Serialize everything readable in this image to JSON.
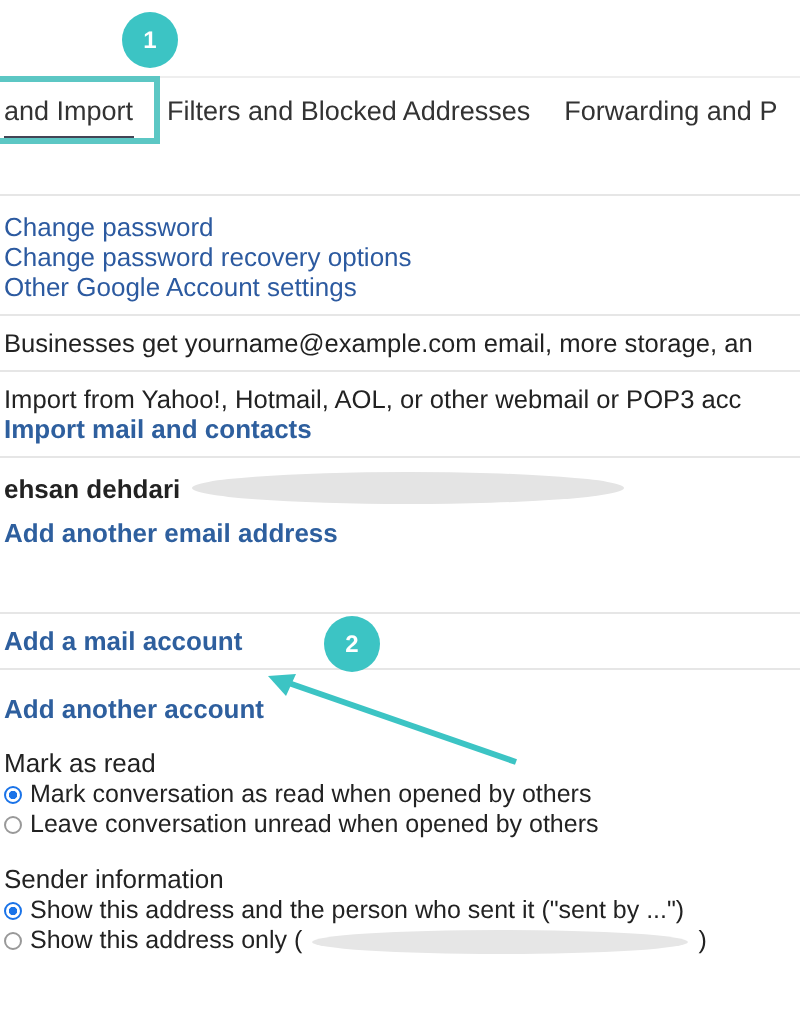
{
  "tabs": [
    {
      "label": "and Import",
      "selected": true
    },
    {
      "label": "Filters and Blocked Addresses",
      "selected": false
    },
    {
      "label": "Forwarding and P",
      "selected": false
    }
  ],
  "account_links": [
    "Change password",
    "Change password recovery options",
    "Other Google Account settings"
  ],
  "business_text": "Businesses get yourname@example.com email, more storage, an",
  "import": {
    "text": "Import from Yahoo!, Hotmail, AOL, or other webmail or POP3 acc",
    "link": "Import mail and contacts"
  },
  "send_as": {
    "name": "ehsan dehdari",
    "link": "Add another email address"
  },
  "check_mail": {
    "link": "Add a mail account"
  },
  "grant_access": {
    "link": "Add another account"
  },
  "mark_as_read": {
    "title": "Mark as read",
    "options": [
      {
        "label": "Mark conversation as read when opened by others",
        "selected": true
      },
      {
        "label": "Leave conversation unread when opened by others",
        "selected": false
      }
    ]
  },
  "sender_information": {
    "title": "Sender information",
    "options": [
      {
        "label": "Show this address and the person who sent it (\"sent by ...\")",
        "selected": true
      },
      {
        "label": "Show this address only (",
        "selected": false,
        "tail": ")"
      }
    ]
  },
  "annotations": [
    {
      "kind": "badge",
      "label": "1"
    },
    {
      "kind": "badge",
      "label": "2"
    },
    {
      "kind": "arrow"
    },
    {
      "kind": "frame"
    }
  ]
}
